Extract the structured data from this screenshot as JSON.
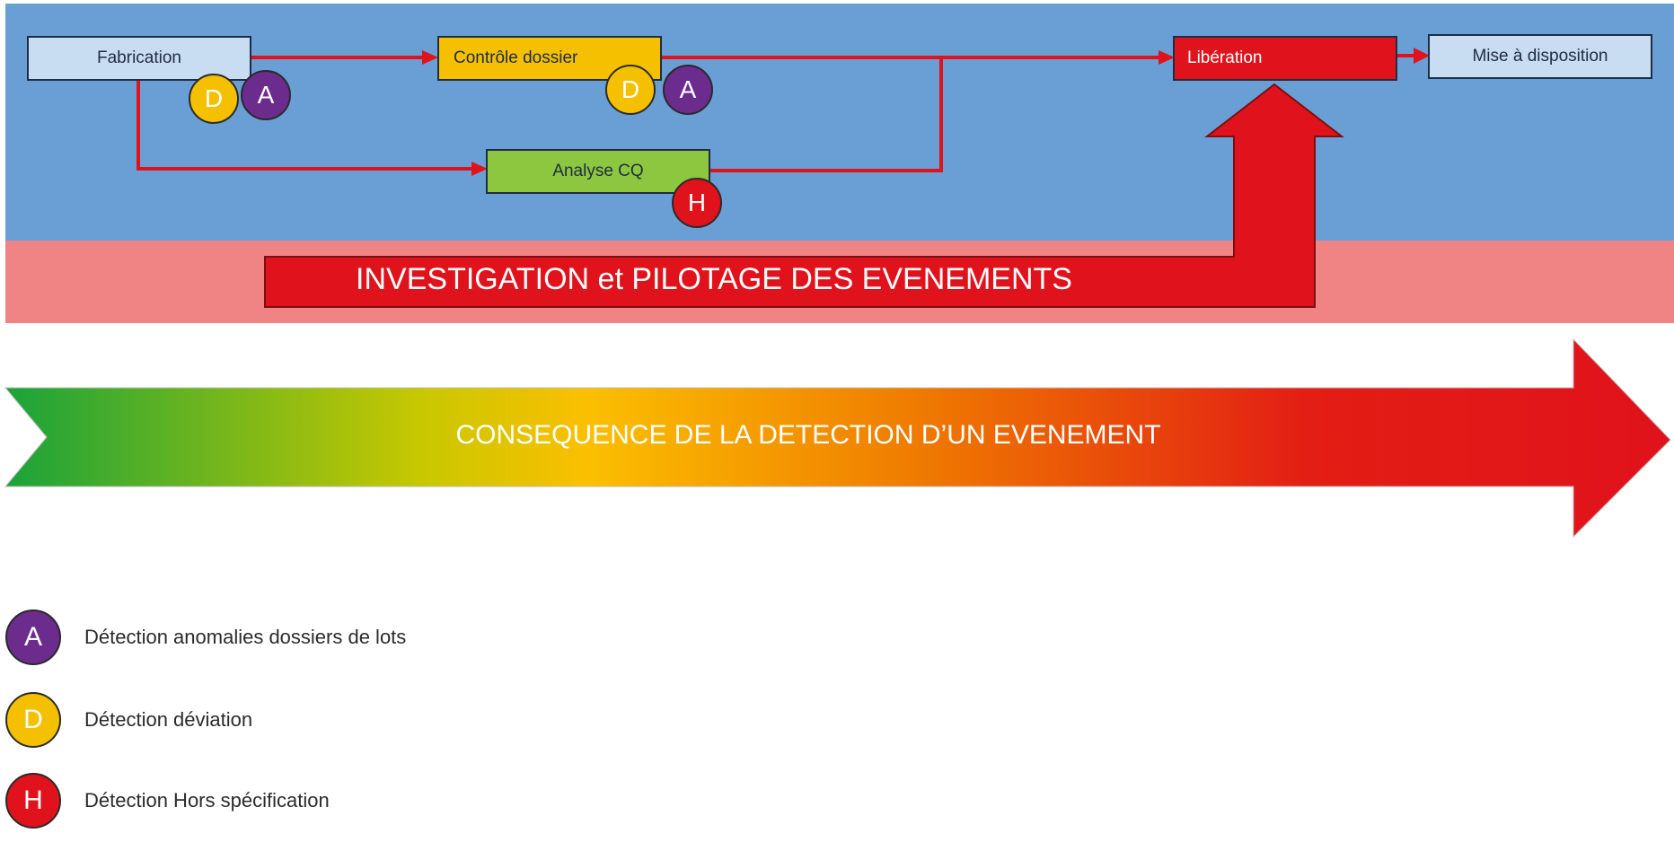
{
  "process": {
    "steps": [
      {
        "id": "fabrication",
        "label": "Fabrication"
      },
      {
        "id": "controle",
        "label": "Contrôle dossier"
      },
      {
        "id": "analyse",
        "label": "Analyse CQ"
      },
      {
        "id": "liberation",
        "label": "Libération"
      },
      {
        "id": "mise",
        "label": "Mise à disposition"
      }
    ],
    "badges": {
      "fabrication": [
        "D",
        "A"
      ],
      "controle": [
        "D",
        "A"
      ],
      "analyse": [
        "H"
      ]
    }
  },
  "investigation_label": "INVESTIGATION et PILOTAGE DES EVENEMENTS",
  "consequence_label": "CONSEQUENCE DE LA DETECTION D’UN EVENEMENT",
  "colors": {
    "process_band": "#6a9fd5",
    "investigation_band": "#f08484",
    "flow_red": "#e0121b",
    "deviation_yellow": "#f5c000",
    "anomaly_purple": "#6b2c8e",
    "gradient": [
      "#1aa33a",
      "#c8c800",
      "#fbbf00",
      "#ef7a00",
      "#e31e14",
      "#e0121b"
    ]
  },
  "legend": [
    {
      "letter": "A",
      "label": "Détection anomalies dossiers de lots"
    },
    {
      "letter": "D",
      "label": "Détection déviation"
    },
    {
      "letter": "H",
      "label": "Détection Hors spécification"
    }
  ]
}
